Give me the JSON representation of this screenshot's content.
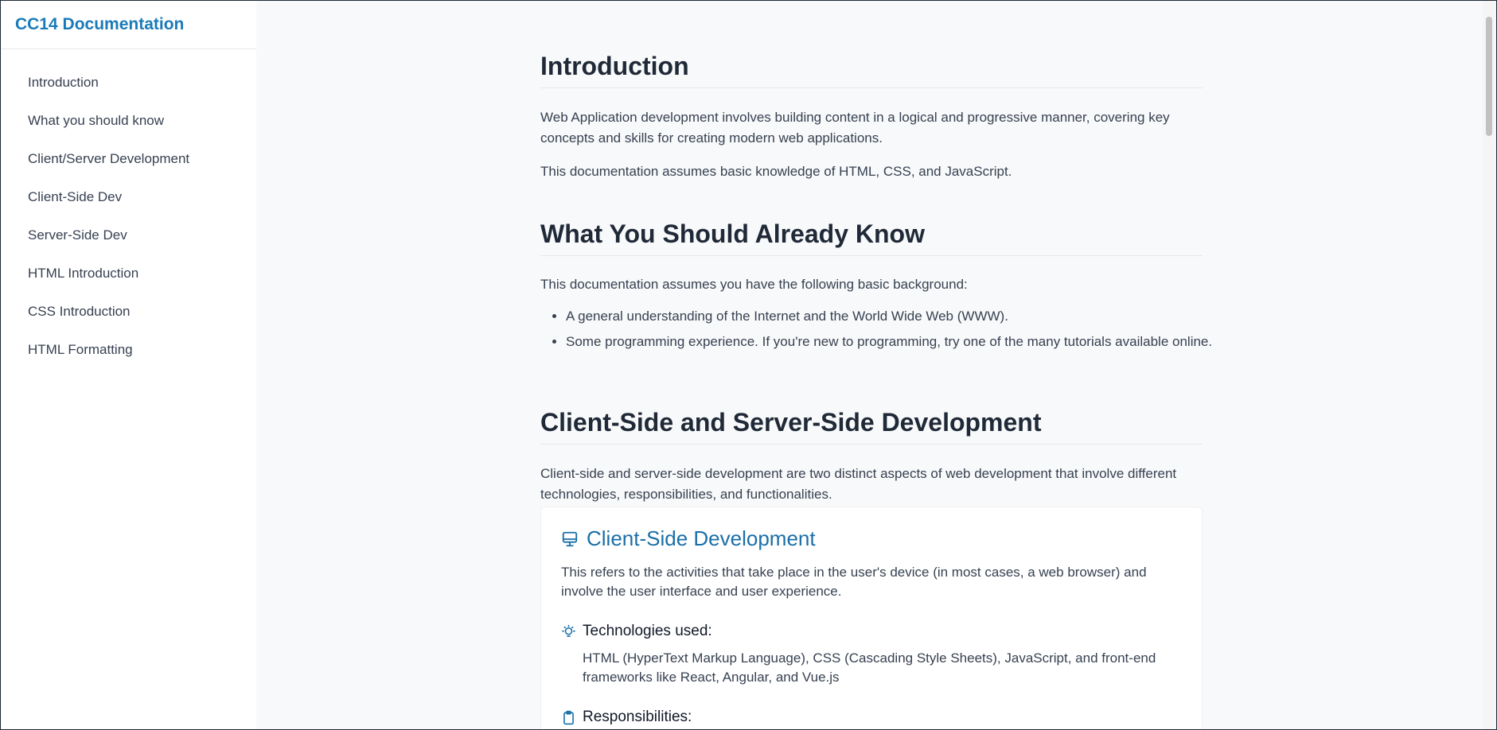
{
  "sidebar": {
    "title": "CC14 Documentation",
    "items": [
      {
        "label": "Introduction"
      },
      {
        "label": "What you should know"
      },
      {
        "label": "Client/Server Development"
      },
      {
        "label": "Client-Side Dev"
      },
      {
        "label": "Server-Side Dev"
      },
      {
        "label": "HTML Introduction"
      },
      {
        "label": "CSS Introduction"
      },
      {
        "label": "HTML Formatting"
      }
    ]
  },
  "main": {
    "intro": {
      "heading": "Introduction",
      "p1": "Web Application development involves building content in a logical and progressive manner, covering key concepts and skills for creating modern web applications.",
      "p2": "This documentation assumes basic knowledge of HTML, CSS, and JavaScript."
    },
    "know": {
      "heading": "What You Should Already Know",
      "p1": "This documentation assumes you have the following basic background:",
      "bullets": [
        "A general understanding of the Internet and the World Wide Web (WWW).",
        "Some programming experience. If you're new to programming, try one of the many tutorials available online."
      ]
    },
    "clientserver": {
      "heading": "Client-Side and Server-Side Development",
      "p1": "Client-side and server-side development are two distinct aspects of web development that involve different technologies, responsibilities, and functionalities."
    },
    "card": {
      "title": "Client-Side Development",
      "icon": "monitor-icon",
      "description": "This refers to the activities that take place in the user's device (in most cases, a web browser) and involve the user interface and user experience.",
      "tech_heading": "Technologies used:",
      "tech_icon": "lightbulb-icon",
      "tech_text": "HTML (HyperText Markup Language), CSS (Cascading Style Sheets), JavaScript, and front-end frameworks like React, Angular, and Vue.js",
      "resp_heading": "Responsibilities:",
      "resp_icon": "clipboard-icon"
    }
  },
  "colors": {
    "accent": "#1a7bb8",
    "card_title": "#1a6fa8",
    "heading": "#1f2937",
    "body_text": "#374151",
    "background": "#f8f9fa"
  }
}
